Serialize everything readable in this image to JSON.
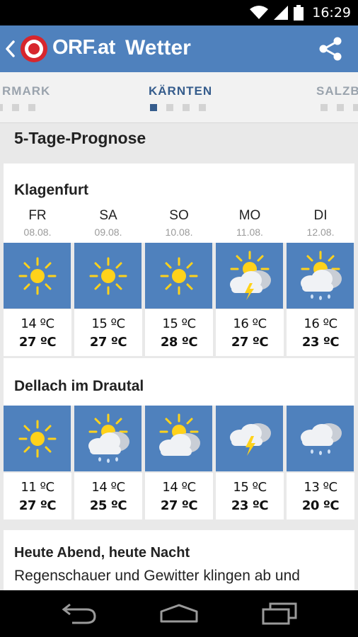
{
  "status": {
    "time": "16:29",
    "icons": [
      "wifi-icon",
      "signal-icon",
      "battery-icon"
    ]
  },
  "appbar": {
    "logo_text": "ORF.at",
    "title": "Wetter",
    "back_icon": "chevron-left-icon",
    "share_icon": "share-icon",
    "color": "#4f81bd"
  },
  "regions": {
    "tabs": [
      {
        "label": "RMARK",
        "active": false
      },
      {
        "label": "KÄRNTEN",
        "active": true
      },
      {
        "label": "SALZB",
        "active": false
      }
    ],
    "active_color": "#355c8c"
  },
  "forecast": {
    "section_title": "5-Tage-Prognose",
    "days": [
      {
        "name": "FR",
        "date": "08.08."
      },
      {
        "name": "SA",
        "date": "09.08."
      },
      {
        "name": "SO",
        "date": "10.08."
      },
      {
        "name": "MO",
        "date": "11.08."
      },
      {
        "name": "DI",
        "date": "12.08."
      }
    ],
    "locations": [
      {
        "name": "Klagenfurt",
        "items": [
          {
            "icon": "sun-icon",
            "min": "14 ºC",
            "max": "27 ºC"
          },
          {
            "icon": "sun-icon",
            "min": "15 ºC",
            "max": "27 ºC"
          },
          {
            "icon": "sun-icon",
            "min": "15 ºC",
            "max": "28 ºC"
          },
          {
            "icon": "sun-thunder-cloud-icon",
            "min": "16 ºC",
            "max": "27 ºC"
          },
          {
            "icon": "sun-rain-cloud-icon",
            "min": "16 ºC",
            "max": "23 ºC"
          }
        ]
      },
      {
        "name": "Dellach im Drautal",
        "items": [
          {
            "icon": "sun-icon",
            "min": "11 ºC",
            "max": "27 ºC"
          },
          {
            "icon": "sun-rain-cloud-icon",
            "min": "14 ºC",
            "max": "25 ºC"
          },
          {
            "icon": "sun-cloud-icon",
            "min": "14 ºC",
            "max": "27 ºC"
          },
          {
            "icon": "thunder-cloud-icon",
            "min": "15 ºC",
            "max": "23 ºC"
          },
          {
            "icon": "rain-cloud-icon",
            "min": "13 ºC",
            "max": "20 ºC"
          }
        ]
      }
    ]
  },
  "text_forecast": {
    "title": "Heute Abend, heute Nacht",
    "body": "Regenschauer und Gewitter klingen ab und"
  },
  "navbar": {
    "icons": [
      "back-nav-icon",
      "home-nav-icon",
      "recents-nav-icon"
    ]
  }
}
